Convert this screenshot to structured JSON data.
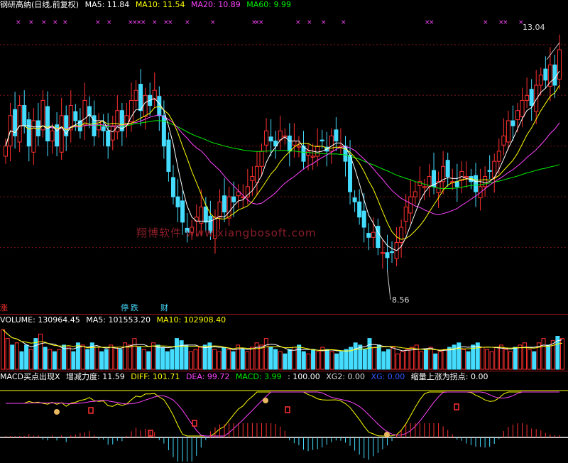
{
  "header": {
    "title": "钢研高纳(日线,前复权)",
    "ma5": "MA5: 11.84",
    "ma10": "MA10: 11.54",
    "ma20": "MA20: 10.89",
    "ma60": "MA60: 9.99",
    "colors": {
      "title": "#ffffff",
      "ma5": "#ffffff",
      "ma10": "#ffff00",
      "ma20": "#ff44ff",
      "ma60": "#00ee00"
    }
  },
  "price_panel": {
    "high_label": "13.04",
    "low_label": "8.56",
    "watermark": "翔博软件 www.xiangbosoft.com",
    "bottom_markers": {
      "zhang": "涨",
      "ting": "停",
      "die": "跌",
      "cai": "财"
    },
    "marker_colors": {
      "zhang": "#ff3030",
      "ting": "#44ddff",
      "die": "#44ddff",
      "cai": "#44ddff"
    }
  },
  "volume_header": {
    "volume": "VOLUME: 130964.45",
    "ma5": "MA5: 101553.20",
    "ma10": "MA10: 102908.40"
  },
  "macd_header": {
    "name": "MACD买点出现X",
    "zengjian": "增减力度: 11.59",
    "diff": "DIFF: 101.71",
    "dea": "DEA: 99.72",
    "macd": "MACD: 3.99",
    "extra": ": 100.00",
    "xg2": "XG2: 0.00",
    "xg": "XG: 0.00",
    "suoliang": "缩量上涨为拐点: 0.00"
  },
  "chart_data": {
    "type": "candlestick",
    "title": "钢研高纳(日线,前复权)",
    "ylim": [
      8.0,
      13.6
    ],
    "price_max": 13.04,
    "price_min": 8.56,
    "moving_averages": {
      "MA5": 11.84,
      "MA10": 11.54,
      "MA20": 10.89,
      "MA60": 9.99
    },
    "candles_close": [
      11.0,
      11.6,
      11.2,
      11.8,
      11.4,
      11.0,
      11.5,
      11.2,
      11.9,
      11.1,
      11.3,
      11.0,
      11.6,
      11.2,
      11.8,
      11.5,
      11.3,
      11.9,
      11.6,
      11.2,
      11.5,
      11.3,
      11.0,
      11.4,
      11.7,
      11.3,
      11.6,
      11.9,
      12.1,
      11.7,
      12.0,
      11.8,
      12.1,
      11.6,
      11.0,
      10.5,
      10.0,
      9.8,
      9.5,
      9.3,
      9.4,
      9.6,
      9.8,
      9.5,
      9.3,
      9.6,
      9.9,
      9.7,
      10.0,
      9.9,
      10.1,
      10.0,
      10.2,
      10.4,
      10.6,
      10.9,
      11.3,
      11.1,
      11.0,
      11.3,
      11.2,
      10.9,
      11.1,
      11.0,
      10.7,
      10.9,
      10.8,
      11.0,
      11.1,
      10.9,
      11.2,
      11.1,
      11.0,
      10.7,
      10.1,
      9.9,
      9.6,
      9.4,
      9.2,
      9.3,
      9.0,
      8.9,
      8.8,
      8.9,
      9.1,
      9.4,
      9.8,
      10.0,
      10.1,
      10.3,
      10.2,
      10.4,
      10.2,
      10.3,
      10.6,
      10.4,
      10.3,
      10.2,
      10.5,
      10.4,
      10.3,
      10.1,
      10.2,
      10.4,
      10.5,
      10.7,
      10.9,
      11.2,
      11.5,
      11.4,
      11.7,
      11.9,
      12.0,
      11.8,
      12.2,
      12.4,
      12.3,
      12.6,
      12.2,
      12.9
    ],
    "volume": {
      "VOLUME": 130964.45,
      "MA5": 101553.2,
      "MA10": 102908.4
    },
    "volume_bars": [
      90,
      70,
      55,
      60,
      40,
      55,
      45,
      70,
      80,
      50,
      45,
      40,
      45,
      55,
      50,
      40,
      60,
      55,
      45,
      60,
      50,
      40,
      45,
      55,
      50,
      45,
      60,
      55,
      70,
      50,
      45,
      40,
      60,
      55,
      50,
      40,
      45,
      70,
      65,
      55,
      40,
      45,
      50,
      55,
      60,
      45,
      40,
      50,
      45,
      40,
      55,
      45,
      40,
      50,
      60,
      55,
      70,
      50,
      45,
      40,
      35,
      45,
      50,
      55,
      40,
      35,
      45,
      40,
      50,
      45,
      40,
      35,
      40,
      45,
      50,
      60,
      55,
      45,
      70,
      50,
      55,
      40,
      45,
      50,
      35,
      40,
      45,
      50,
      55,
      40,
      45,
      50,
      35,
      40,
      45,
      50,
      55,
      60,
      45,
      40,
      55,
      60,
      50,
      45,
      40,
      50,
      55,
      45,
      40,
      50,
      55,
      60,
      45,
      40,
      60,
      70,
      55,
      65,
      75,
      70
    ],
    "macd": {
      "DIFF": 101.71,
      "DEA": 99.72,
      "MACD": 3.99,
      "增减力度": 11.59,
      "XG2": 0.0,
      "XG": 0.0,
      "缩量上涨为拐点": 0.0
    }
  }
}
